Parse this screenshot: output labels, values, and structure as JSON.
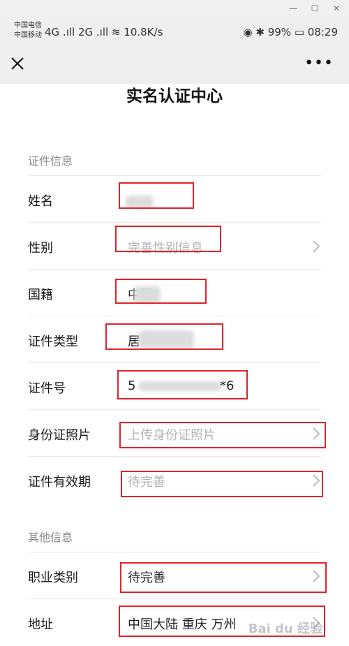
{
  "statusbar": {
    "carrier1": "中国电信",
    "carrier2": "中国移动",
    "left": "4G .ıll 2G .ıll  ≋  10.8K/s",
    "right": "◉  ✱ 99%  ▭  08:29",
    "time": "08:29",
    "battery": "99%"
  },
  "page": {
    "title": "实名认证中心"
  },
  "sections": {
    "cert": "证件信息",
    "other": "其他信息"
  },
  "rows": {
    "name": {
      "label": "姓名"
    },
    "gender": {
      "label": "性别",
      "placeholder": "完善性别信息"
    },
    "nationality": {
      "label": "国籍",
      "value": "中国"
    },
    "id_type": {
      "label": "证件类型",
      "value": "居"
    },
    "id_number": {
      "label": "证件号",
      "value_start": "5",
      "value_end": "*6"
    },
    "id_photo": {
      "label": "身份证照片",
      "placeholder": "上传身份证照片"
    },
    "validity": {
      "label": "证件有效期",
      "placeholder": "待完善"
    },
    "occupation": {
      "label": "职业类别",
      "value": "待完善"
    },
    "address": {
      "label": "地址",
      "value": "中国大陆 重庆 万州"
    }
  },
  "icons": {
    "close": "close-icon",
    "more": "more-icon",
    "chevron": "chevron-right-icon"
  },
  "colors": {
    "highlight_box": "#e0232a",
    "navbar_bg": "#efefef"
  },
  "watermark": "Bai du 经验"
}
